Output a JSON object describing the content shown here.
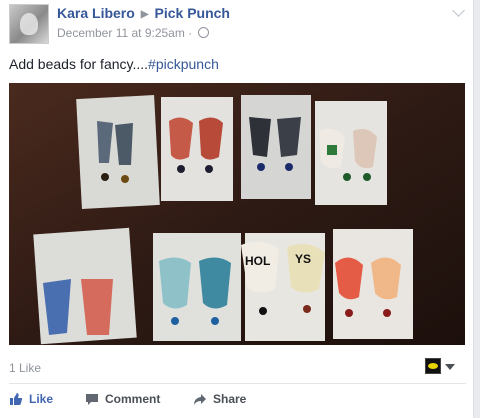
{
  "post": {
    "author": "Kara Libero",
    "page": "Pick Punch",
    "timestamp": "December 11 at 9:25am",
    "separator": "·",
    "text": "Add beads for fancy....",
    "hashtag": "#pickpunch",
    "likes": "1 Like"
  },
  "icons": {
    "audience": "globe-icon",
    "options": "chevron-down-icon",
    "page_avatar": "pick-punch-avatar-icon",
    "like": "thumbs-up-icon",
    "comment": "speech-bubble-icon",
    "share": "share-arrow-icon"
  },
  "actions": {
    "like": "Like",
    "comment": "Comment",
    "share": "Share"
  },
  "colors": {
    "link": "#365899",
    "like_active": "#4267b2",
    "muted": "#90949c"
  }
}
